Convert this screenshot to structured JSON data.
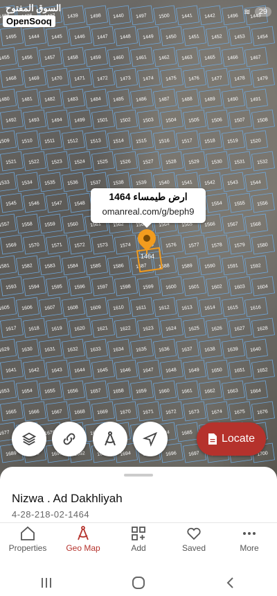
{
  "status": {
    "battery": "29"
  },
  "brand": {
    "watermark_ar": "السوق المفتوح",
    "logo": "OpenSooq"
  },
  "map": {
    "callout_title": "ارض طيمساء 1464",
    "callout_url": "omanreal.com/g/beph9",
    "plot_label": "1464",
    "plot_numbers": [
      "1438",
      "1436",
      "1437",
      "1439",
      "1498",
      "1440",
      "1497",
      "1500",
      "1441",
      "1442",
      "1496",
      "1443",
      "1495",
      "1444",
      "1445",
      "1446",
      "1447",
      "1448",
      "1449",
      "1450",
      "1451",
      "1452",
      "1453",
      "1454",
      "1455",
      "1456",
      "1457",
      "1458",
      "1459",
      "1460",
      "1461",
      "1462",
      "1463",
      "1465",
      "1466",
      "1467",
      "1468",
      "1469",
      "1470",
      "1471",
      "1472",
      "1473",
      "1474",
      "1475",
      "1476",
      "1477",
      "1478",
      "1479",
      "1480",
      "1481",
      "1482",
      "1483",
      "1484",
      "1485",
      "1486",
      "1487",
      "1488",
      "1489",
      "1490",
      "1491",
      "1492",
      "1493",
      "1494",
      "1499",
      "1501",
      "1502",
      "1503",
      "1504",
      "1505",
      "1506",
      "1507",
      "1508",
      "1509",
      "1510",
      "1511",
      "1512",
      "1513",
      "1514",
      "1515",
      "1516",
      "1517",
      "1518",
      "1519",
      "1520",
      "1521",
      "1522",
      "1523",
      "1524",
      "1525",
      "1526",
      "1527",
      "1528",
      "1529",
      "1530",
      "1531",
      "1532",
      "1533",
      "1534",
      "1535",
      "1536",
      "1537",
      "1538",
      "1539",
      "1540",
      "1541",
      "1542",
      "1543",
      "1544",
      "1545",
      "1546",
      "1547",
      "1548",
      "1549",
      "1550",
      "1551",
      "1552",
      "1553",
      "1554",
      "1555",
      "1556",
      "1557",
      "1558",
      "1559",
      "1560",
      "1561",
      "1562",
      "1563",
      "1564",
      "1565",
      "1566",
      "1567",
      "1568",
      "1569",
      "1570",
      "1571",
      "1572",
      "1573",
      "1574",
      "1575",
      "1576",
      "1577",
      "1578",
      "1579",
      "1580",
      "1581",
      "1582",
      "1583",
      "1584",
      "1585",
      "1586",
      "1587",
      "1588",
      "1589",
      "1590",
      "1591",
      "1592",
      "1593",
      "1594",
      "1595",
      "1596",
      "1597",
      "1598",
      "1599",
      "1600",
      "1601",
      "1602",
      "1603",
      "1604",
      "1605",
      "1606",
      "1607",
      "1608",
      "1609",
      "1610",
      "1611",
      "1612",
      "1613",
      "1614",
      "1615",
      "1616",
      "1617",
      "1618",
      "1619",
      "1620",
      "1621",
      "1622",
      "1623",
      "1624",
      "1625",
      "1626",
      "1627",
      "1628",
      "1629",
      "1630",
      "1631",
      "1632",
      "1633",
      "1634",
      "1635",
      "1636",
      "1637",
      "1638",
      "1639",
      "1640",
      "1641",
      "1642",
      "1643",
      "1644",
      "1645",
      "1646",
      "1647",
      "1648",
      "1649",
      "1650",
      "1651",
      "1652",
      "1653",
      "1654",
      "1655",
      "1656",
      "1657",
      "1658",
      "1659",
      "1660",
      "1661",
      "1662",
      "1663",
      "1664",
      "1665",
      "1666",
      "1667",
      "1668",
      "1669",
      "1670",
      "1671",
      "1672",
      "1673",
      "1674",
      "1675",
      "1676",
      "1677",
      "1678",
      "1679",
      "1680",
      "1681",
      "1682",
      "1683",
      "1684",
      "1685",
      "1686",
      "1687",
      "1688",
      "1689",
      "1690",
      "1691",
      "1692",
      "1693",
      "1694",
      "1695",
      "1696",
      "1697",
      "1698",
      "1699",
      "1700"
    ]
  },
  "buttons": {
    "locate": "Locate"
  },
  "sheet": {
    "title": "Nizwa . Ad Dakhliyah",
    "subtitle": "4-28-218-02-1464"
  },
  "tabs": [
    {
      "label": "Properties",
      "icon": "home-icon"
    },
    {
      "label": "Geo Map",
      "icon": "geo-map-icon"
    },
    {
      "label": "Add",
      "icon": "add-grid-icon"
    },
    {
      "label": "Saved",
      "icon": "heart-icon"
    },
    {
      "label": "More",
      "icon": "more-dots-icon"
    }
  ],
  "colors": {
    "accent": "#b5322c",
    "pin": "#f39c1e",
    "parcel_line": "#6fa8dc"
  }
}
